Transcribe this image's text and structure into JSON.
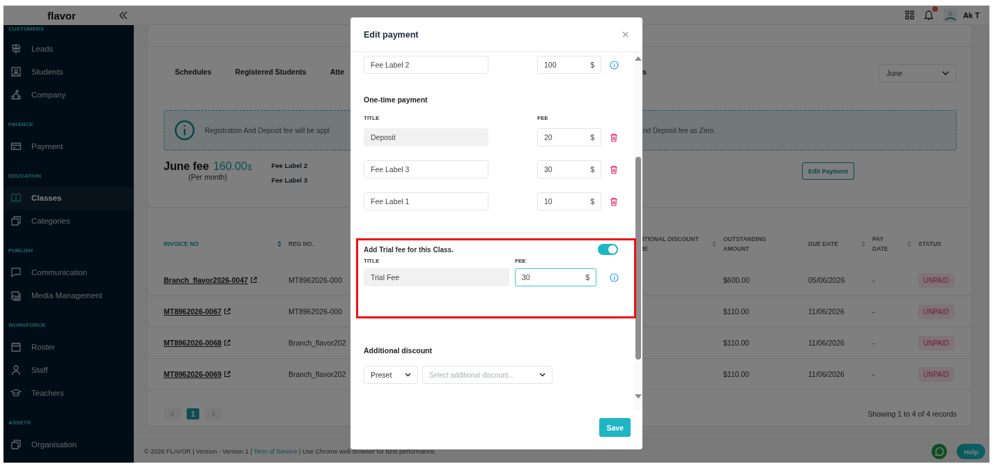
{
  "topbar": {
    "logo": "flavor",
    "user": "Ak T",
    "has_notifications": true
  },
  "sidebar": {
    "sections": [
      {
        "label": "CUSTOMERS",
        "items": [
          {
            "label": "Leads",
            "selected": false
          },
          {
            "label": "Students",
            "selected": false
          },
          {
            "label": "Company",
            "selected": false
          }
        ]
      },
      {
        "label": "FINANCE",
        "items": [
          {
            "label": "Payment",
            "selected": false
          }
        ]
      },
      {
        "label": "EDUCATION",
        "items": [
          {
            "label": "Classes",
            "selected": true
          },
          {
            "label": "Categories",
            "selected": false
          }
        ]
      },
      {
        "label": "PUBLISH",
        "items": [
          {
            "label": "Communication",
            "selected": false
          },
          {
            "label": "Media Management",
            "selected": false
          }
        ]
      },
      {
        "label": "WORKFORCE",
        "items": [
          {
            "label": "Roster",
            "selected": false
          },
          {
            "label": "Staff",
            "selected": false
          },
          {
            "label": "Teachers",
            "selected": false
          }
        ]
      },
      {
        "label": "ASSETS",
        "items": [
          {
            "label": "Organisation",
            "selected": false
          }
        ]
      }
    ]
  },
  "page": {
    "tabs": [
      {
        "label": "Schedules",
        "selected": false
      },
      {
        "label": "Registered Students",
        "selected": false
      },
      {
        "label": "Atte",
        "selected": false
      }
    ],
    "tab_fragment": "s",
    "month_select": {
      "value": "June"
    },
    "notice": {
      "text_left": "Registration And Deposit fee will be appl",
      "text_right": "nd Deposit fee as Zero."
    },
    "fee_summary": {
      "title": "June fee",
      "amount": "160.00",
      "currency": "$",
      "period": "(Per month)",
      "labels": [
        "Fee Label 2",
        "Fee Label 3"
      ]
    },
    "edit_button": "Edit Payment",
    "table": {
      "columns": [
        {
          "label": "INVOICE NO",
          "sortable": true,
          "active": true
        },
        {
          "label": "REG NO.",
          "sortable": false,
          "active": false
        },
        {
          "label": "ITIONAL DISCOUNT\nIE",
          "sortable": true,
          "active": false
        },
        {
          "label": "OUTSTANDING\nAMOUNT",
          "sortable": false,
          "active": false
        },
        {
          "label": "DUE DATE",
          "sortable": true,
          "active": false
        },
        {
          "label": "PAY\nDATE",
          "sortable": true,
          "active": false
        },
        {
          "label": "STATUS",
          "sortable": false,
          "active": false
        }
      ],
      "rows": [
        {
          "invoice": "Branch_flavor2026-0047",
          "reg_no": "MT8962026-000",
          "outstanding": "$600.00",
          "due_date": "05/06/2026",
          "pay_date": "-",
          "status": {
            "label": "UNPAID",
            "kind": "unpaid"
          }
        },
        {
          "invoice": "MT8962026-0067",
          "reg_no": "MT8962026-000",
          "outstanding": "$110.00",
          "due_date": "11/06/2026",
          "pay_date": "-",
          "status": {
            "label": "UNPAID",
            "kind": "unpaid"
          }
        },
        {
          "invoice": "MT8962026-0068",
          "reg_no": "Branch_flavor202",
          "outstanding": "$110.00",
          "due_date": "11/06/2026",
          "pay_date": "-",
          "status": {
            "label": "UNPAID",
            "kind": "unpaid"
          }
        },
        {
          "invoice": "MT8962026-0069",
          "reg_no": "Branch_flavor202",
          "outstanding": "$110.00",
          "due_date": "11/06/2026",
          "pay_date": "-",
          "status": {
            "label": "UNPAID",
            "kind": "unpaid"
          }
        }
      ]
    },
    "pagination": {
      "pages": [
        {
          "label": "1",
          "selected": true
        }
      ],
      "summary": "Showing 1 to 4 of 4 records"
    }
  },
  "footer": {
    "text_before": "© 2026 FLAVOR | Version - Version 1 | ",
    "link": "Term of Service",
    "text_after": " | Use Chrome web browser for best performance."
  },
  "help_button": "Help",
  "modal": {
    "title": "Edit payment",
    "recurring": [
      {
        "title": "Fee Label 2",
        "fee": "100",
        "currency": "$"
      }
    ],
    "one_time": {
      "heading": "One-time payment",
      "title_label": "TITLE",
      "fee_label": "FEE",
      "rows": [
        {
          "title": "Deposit",
          "disabled": true,
          "fee": "20",
          "currency": "$"
        },
        {
          "title": "Fee Label 3",
          "disabled": false,
          "fee": "30",
          "currency": "$"
        },
        {
          "title": "Fee Label 1",
          "disabled": false,
          "fee": "10",
          "currency": "$"
        }
      ]
    },
    "trial": {
      "heading": "Add Trial fee for this Class.",
      "enabled": true,
      "highlighted": true,
      "title_label": "TITLE",
      "fee_label": "FEE",
      "title": "Trial Fee",
      "title_disabled": true,
      "fee": "30",
      "currency": "$",
      "fee_focused": true
    },
    "discount": {
      "heading": "Additional discount",
      "preset": "Preset",
      "placeholder": "Select additional discount..."
    },
    "save": "Save"
  }
}
